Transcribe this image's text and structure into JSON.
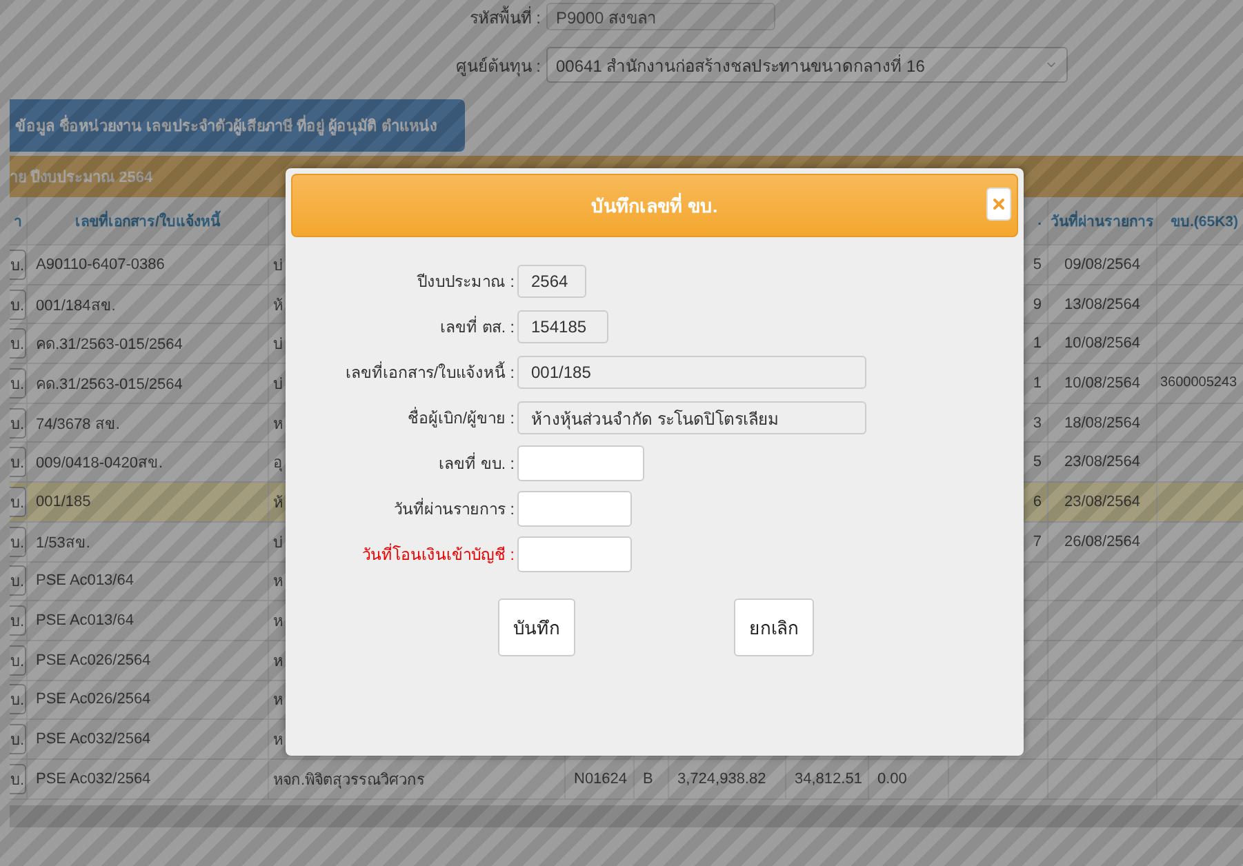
{
  "filters": [
    {
      "label": "รหัสพื้นที่ :",
      "value": "P9000 สงขลา",
      "kind": "text"
    },
    {
      "label": "ศูนย์ต้นทุน :",
      "value": "00641 สำนักงานก่อสร้างชลประทานขนาดกลางที่ 16",
      "kind": "select"
    }
  ],
  "info_button": "ข้อมูล ชื่อหน่วยงาน เลขประจำตัวผู้เสียภาษี ที่อยู่ ผู้อนุมัติ ตำแหน่ง",
  "table": {
    "caption": "าย ปีงบประมาณ 2564",
    "columns": [
      "า",
      "เลขที่เอกสาร/ใบแจ้งหนี้",
      "",
      "",
      "",
      "",
      "",
      "",
      ".",
      "วันที่ผ่านรายการ",
      "ขบ.(65K3)"
    ],
    "rows": [
      {
        "selected": false,
        "cells": [
          "บ.",
          "A90110-6407-0386",
          "บ่",
          "",
          "",
          "",
          "",
          "",
          "5",
          "09/08/2564",
          ""
        ]
      },
      {
        "selected": false,
        "cells": [
          "บ.",
          "001/184สข.",
          "ห้",
          "",
          "",
          "",
          "",
          "",
          "9",
          "13/08/2564",
          ""
        ]
      },
      {
        "selected": false,
        "cells": [
          "บ.",
          "คด.31/2563-015/2564",
          "บ่",
          "",
          "",
          "",
          "",
          "",
          "1",
          "10/08/2564",
          ""
        ]
      },
      {
        "selected": false,
        "cells": [
          "บ.",
          "คด.31/2563-015/2564",
          "บ่",
          "",
          "",
          "",
          "",
          "",
          "1",
          "10/08/2564",
          "3600005243"
        ]
      },
      {
        "selected": false,
        "cells": [
          "บ.",
          "74/3678 สข.",
          "ห",
          "",
          "",
          "",
          "",
          "",
          "3",
          "18/08/2564",
          ""
        ]
      },
      {
        "selected": false,
        "cells": [
          "บ.",
          "009/0418-0420สข.",
          "อุ",
          "",
          "",
          "",
          "",
          "",
          "5",
          "23/08/2564",
          ""
        ]
      },
      {
        "selected": true,
        "cells": [
          "บ.",
          "001/185",
          "ห้",
          "",
          "",
          "",
          "",
          "",
          "6",
          "23/08/2564",
          ""
        ]
      },
      {
        "selected": false,
        "cells": [
          "บ.",
          "1/53สข.",
          "บ่",
          "",
          "",
          "",
          "",
          "",
          "7",
          "26/08/2564",
          ""
        ]
      },
      {
        "selected": false,
        "cells": [
          "บ.",
          "PSE Ac013/64",
          "ห",
          "",
          "",
          "",
          "",
          "",
          "",
          "",
          ""
        ]
      },
      {
        "selected": false,
        "cells": [
          "บ.",
          "PSE Ac013/64",
          "ห",
          "",
          "",
          "",
          "",
          "",
          "",
          "",
          ""
        ]
      },
      {
        "selected": false,
        "cells": [
          "บ.",
          "PSE Ac026/2564",
          "ห",
          "",
          "",
          "",
          "",
          "",
          "",
          "",
          ""
        ]
      },
      {
        "selected": false,
        "cells": [
          "บ.",
          "PSE Ac026/2564",
          "ห",
          "",
          "",
          "",
          "",
          "",
          "",
          "",
          ""
        ]
      },
      {
        "selected": false,
        "cells": [
          "บ.",
          "PSE Ac032/2564",
          "ห",
          "",
          "",
          "",
          "",
          "",
          "",
          "",
          ""
        ]
      },
      {
        "selected": false,
        "cells": [
          "บ.",
          "PSE Ac032/2564",
          "หจก.พิจิตสุวรรณวิศวกร",
          "N01624",
          "B",
          "3,724,938.82",
          "34,812.51",
          "0.00",
          "",
          "",
          ""
        ]
      }
    ]
  },
  "dialog": {
    "title": "บันทึกเลขที่ ขบ.",
    "fields": [
      {
        "label": "ปีงบประมาณ :",
        "value": "2564",
        "kind": "readonly",
        "required": false
      },
      {
        "label": "เลขที่ ตส. :",
        "value": "154185",
        "kind": "readonly",
        "required": false
      },
      {
        "label": "เลขที่เอกสาร/ใบแจ้งหนี้ :",
        "value": "001/185",
        "kind": "readonly",
        "required": false
      },
      {
        "label": "ชื่อผู้เบิก/ผู้ขาย :",
        "value": "ห้างหุ้นส่วนจำกัด ระโนดปิโตรเลียม",
        "kind": "readonly",
        "required": false
      },
      {
        "label": "เลขที่ ขบ. :",
        "kind": "input",
        "required": false
      },
      {
        "label": "วันที่ผ่านรายการ :",
        "kind": "input",
        "required": false
      },
      {
        "label": "วันที่โอนเงินเข้าบัญชี :",
        "kind": "input",
        "required": true
      }
    ],
    "buttons": [
      "บันทึก",
      "ยกเลิก"
    ]
  }
}
